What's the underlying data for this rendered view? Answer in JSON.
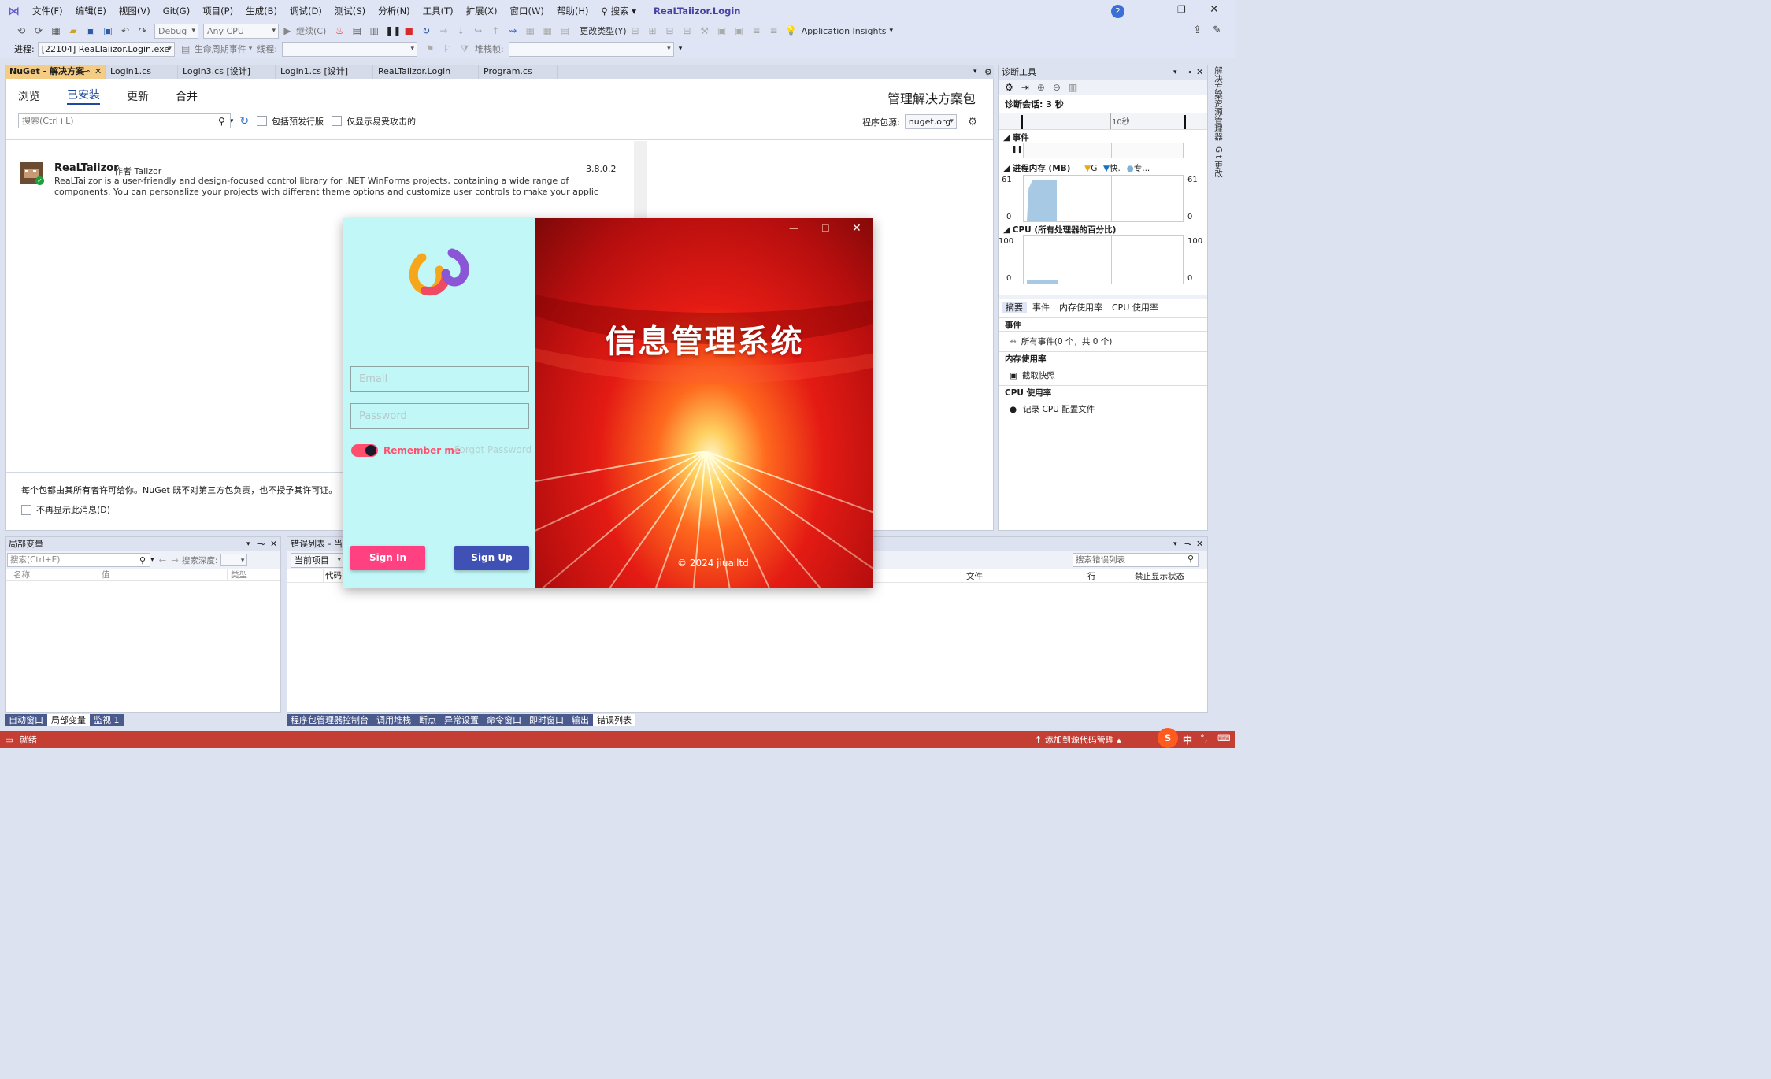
{
  "menu": {
    "items": [
      "文件(F)",
      "编辑(E)",
      "视图(V)",
      "Git(G)",
      "项目(P)",
      "生成(B)",
      "调试(D)",
      "测试(S)",
      "分析(N)",
      "工具(T)",
      "扩展(X)",
      "窗口(W)",
      "帮助(H)"
    ],
    "search": "搜索",
    "solution": "ReaLTaiizor.Login",
    "notify_count": "2"
  },
  "toolbar": {
    "config": "Debug",
    "platform": "Any CPU",
    "continue": "继续(C)",
    "change_type": "更改类型(Y)",
    "insights": "Application Insights"
  },
  "toolbar2": {
    "process_label": "进程:",
    "process": "[22104] ReaLTaiizor.Login.exe",
    "lifecycle": "生命周期事件",
    "thread_label": "线程:",
    "stack_label": "堆栈帧:"
  },
  "doctabs": [
    "NuGet - 解决方案",
    "Login1.cs",
    "Login3.cs [设计]",
    "Login1.cs [设计]",
    "ReaLTaiizor.Login",
    "Program.cs"
  ],
  "nuget": {
    "tabs": [
      "浏览",
      "已安装",
      "更新",
      "合并"
    ],
    "title": "管理解决方案包",
    "search_placeholder": "搜索(Ctrl+L)",
    "prerelease": "包括预发行版",
    "vulnerable": "仅显示易受攻击的",
    "source_label": "程序包源:",
    "source": "nuget.org",
    "pkg_name": "ReaLTaiizor",
    "pkg_by": "作者 Taiizor",
    "pkg_version": "3.8.0.2",
    "pkg_desc1": "ReaLTaiizor is a user-friendly and design-focused control library for .NET WinForms projects, containing a wide range of",
    "pkg_desc2": "components. You can personalize your projects with different theme options and customize user controls to make your applicati...",
    "license": "每个包都由其所有者许可给你。NuGet 既不对第三方包负责，也不授予其许可证。",
    "dont_show": "不再显示此消息(D)"
  },
  "diag": {
    "title": "诊断工具",
    "session": "诊断会话: 3 秒",
    "tick": "10秒",
    "events": "事件",
    "memory": "进程内存 (MB)",
    "mem_legend": [
      "G",
      "快.",
      "专..."
    ],
    "mem_max": "61",
    "mem_min": "0",
    "cpu": "CPU (所有处理器的百分比)",
    "cpu_max": "100",
    "cpu_min": "0",
    "tabs": [
      "摘要",
      "事件",
      "内存使用率",
      "CPU 使用率"
    ],
    "sec_events": "事件",
    "all_events": "所有事件(0 个，共 0 个)",
    "sec_mem": "内存使用率",
    "snapshot": "截取快照",
    "sec_cpu": "CPU 使用率",
    "record_cpu": "记录 CPU 配置文件"
  },
  "side": {
    "vertical1": "解决方案资源管理器",
    "vertical2": "Git 更改"
  },
  "locals": {
    "title": "局部变量",
    "search": "搜索(Ctrl+E)",
    "depth": "搜索深度:",
    "cols": [
      "名称",
      "值",
      "类型"
    ],
    "tabs": [
      "自动窗口",
      "局部变量",
      "监视 1"
    ]
  },
  "errors": {
    "title": "错误列表 - 当前...",
    "scope": "当前项目",
    "search": "搜索错误列表",
    "cols": [
      "代码",
      "文件",
      "行",
      "禁止显示状态"
    ],
    "tabs": [
      "程序包管理器控制台",
      "调用堆栈",
      "断点",
      "异常设置",
      "命令窗口",
      "即时窗口",
      "输出",
      "错误列表"
    ]
  },
  "status": {
    "ready": "就绪",
    "source_ctrl": "添加到源代码管理",
    "ime": "中"
  },
  "login": {
    "email_placeholder": "Email",
    "password_placeholder": "Password",
    "remember": "Remember me",
    "forgot": "Forgot Password",
    "signin": "Sign In",
    "signup": "Sign Up",
    "banner": "信息管理系统",
    "copyright": "© 2024 jiuailtd",
    "colors": {
      "left_bg": "#c2f7f7",
      "signin": "#ff4081",
      "signup": "#3f51b5",
      "toggle": "#ff4f6d"
    }
  }
}
